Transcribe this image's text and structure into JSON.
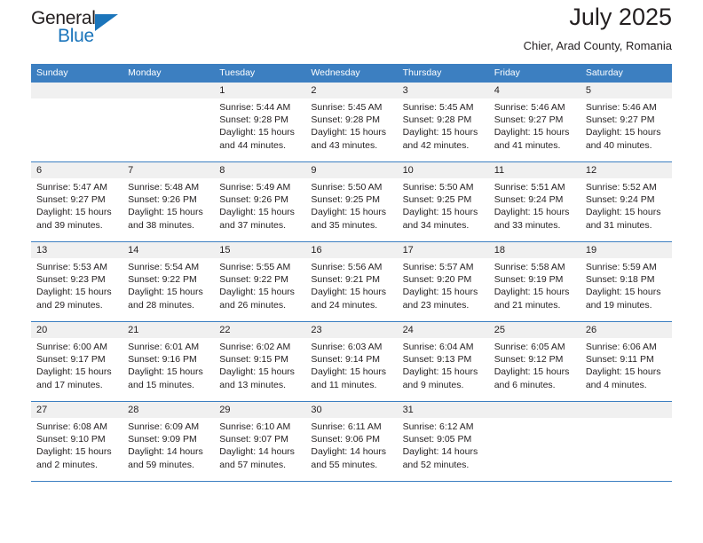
{
  "logo": {
    "word_top": "General",
    "word_bottom": "Blue",
    "triangle_color": "#1b75bb",
    "icon": "general-blue-logo"
  },
  "header": {
    "title": "July 2025",
    "subtitle": "Chier, Arad County, Romania"
  },
  "colors": {
    "header_blue": "#3c7fc1",
    "daynum_band": "#f0f0f0",
    "text": "#231f20",
    "logo_blue": "#1b75bb"
  },
  "weekday_headers": [
    "Sunday",
    "Monday",
    "Tuesday",
    "Wednesday",
    "Thursday",
    "Friday",
    "Saturday"
  ],
  "weeks": [
    [
      {
        "day": "",
        "lines": []
      },
      {
        "day": "",
        "lines": []
      },
      {
        "day": "1",
        "lines": [
          "Sunrise: 5:44 AM",
          "Sunset: 9:28 PM",
          "Daylight: 15 hours",
          "and 44 minutes."
        ]
      },
      {
        "day": "2",
        "lines": [
          "Sunrise: 5:45 AM",
          "Sunset: 9:28 PM",
          "Daylight: 15 hours",
          "and 43 minutes."
        ]
      },
      {
        "day": "3",
        "lines": [
          "Sunrise: 5:45 AM",
          "Sunset: 9:28 PM",
          "Daylight: 15 hours",
          "and 42 minutes."
        ]
      },
      {
        "day": "4",
        "lines": [
          "Sunrise: 5:46 AM",
          "Sunset: 9:27 PM",
          "Daylight: 15 hours",
          "and 41 minutes."
        ]
      },
      {
        "day": "5",
        "lines": [
          "Sunrise: 5:46 AM",
          "Sunset: 9:27 PM",
          "Daylight: 15 hours",
          "and 40 minutes."
        ]
      }
    ],
    [
      {
        "day": "6",
        "lines": [
          "Sunrise: 5:47 AM",
          "Sunset: 9:27 PM",
          "Daylight: 15 hours",
          "and 39 minutes."
        ]
      },
      {
        "day": "7",
        "lines": [
          "Sunrise: 5:48 AM",
          "Sunset: 9:26 PM",
          "Daylight: 15 hours",
          "and 38 minutes."
        ]
      },
      {
        "day": "8",
        "lines": [
          "Sunrise: 5:49 AM",
          "Sunset: 9:26 PM",
          "Daylight: 15 hours",
          "and 37 minutes."
        ]
      },
      {
        "day": "9",
        "lines": [
          "Sunrise: 5:50 AM",
          "Sunset: 9:25 PM",
          "Daylight: 15 hours",
          "and 35 minutes."
        ]
      },
      {
        "day": "10",
        "lines": [
          "Sunrise: 5:50 AM",
          "Sunset: 9:25 PM",
          "Daylight: 15 hours",
          "and 34 minutes."
        ]
      },
      {
        "day": "11",
        "lines": [
          "Sunrise: 5:51 AM",
          "Sunset: 9:24 PM",
          "Daylight: 15 hours",
          "and 33 minutes."
        ]
      },
      {
        "day": "12",
        "lines": [
          "Sunrise: 5:52 AM",
          "Sunset: 9:24 PM",
          "Daylight: 15 hours",
          "and 31 minutes."
        ]
      }
    ],
    [
      {
        "day": "13",
        "lines": [
          "Sunrise: 5:53 AM",
          "Sunset: 9:23 PM",
          "Daylight: 15 hours",
          "and 29 minutes."
        ]
      },
      {
        "day": "14",
        "lines": [
          "Sunrise: 5:54 AM",
          "Sunset: 9:22 PM",
          "Daylight: 15 hours",
          "and 28 minutes."
        ]
      },
      {
        "day": "15",
        "lines": [
          "Sunrise: 5:55 AM",
          "Sunset: 9:22 PM",
          "Daylight: 15 hours",
          "and 26 minutes."
        ]
      },
      {
        "day": "16",
        "lines": [
          "Sunrise: 5:56 AM",
          "Sunset: 9:21 PM",
          "Daylight: 15 hours",
          "and 24 minutes."
        ]
      },
      {
        "day": "17",
        "lines": [
          "Sunrise: 5:57 AM",
          "Sunset: 9:20 PM",
          "Daylight: 15 hours",
          "and 23 minutes."
        ]
      },
      {
        "day": "18",
        "lines": [
          "Sunrise: 5:58 AM",
          "Sunset: 9:19 PM",
          "Daylight: 15 hours",
          "and 21 minutes."
        ]
      },
      {
        "day": "19",
        "lines": [
          "Sunrise: 5:59 AM",
          "Sunset: 9:18 PM",
          "Daylight: 15 hours",
          "and 19 minutes."
        ]
      }
    ],
    [
      {
        "day": "20",
        "lines": [
          "Sunrise: 6:00 AM",
          "Sunset: 9:17 PM",
          "Daylight: 15 hours",
          "and 17 minutes."
        ]
      },
      {
        "day": "21",
        "lines": [
          "Sunrise: 6:01 AM",
          "Sunset: 9:16 PM",
          "Daylight: 15 hours",
          "and 15 minutes."
        ]
      },
      {
        "day": "22",
        "lines": [
          "Sunrise: 6:02 AM",
          "Sunset: 9:15 PM",
          "Daylight: 15 hours",
          "and 13 minutes."
        ]
      },
      {
        "day": "23",
        "lines": [
          "Sunrise: 6:03 AM",
          "Sunset: 9:14 PM",
          "Daylight: 15 hours",
          "and 11 minutes."
        ]
      },
      {
        "day": "24",
        "lines": [
          "Sunrise: 6:04 AM",
          "Sunset: 9:13 PM",
          "Daylight: 15 hours",
          "and 9 minutes."
        ]
      },
      {
        "day": "25",
        "lines": [
          "Sunrise: 6:05 AM",
          "Sunset: 9:12 PM",
          "Daylight: 15 hours",
          "and 6 minutes."
        ]
      },
      {
        "day": "26",
        "lines": [
          "Sunrise: 6:06 AM",
          "Sunset: 9:11 PM",
          "Daylight: 15 hours",
          "and 4 minutes."
        ]
      }
    ],
    [
      {
        "day": "27",
        "lines": [
          "Sunrise: 6:08 AM",
          "Sunset: 9:10 PM",
          "Daylight: 15 hours",
          "and 2 minutes."
        ]
      },
      {
        "day": "28",
        "lines": [
          "Sunrise: 6:09 AM",
          "Sunset: 9:09 PM",
          "Daylight: 14 hours",
          "and 59 minutes."
        ]
      },
      {
        "day": "29",
        "lines": [
          "Sunrise: 6:10 AM",
          "Sunset: 9:07 PM",
          "Daylight: 14 hours",
          "and 57 minutes."
        ]
      },
      {
        "day": "30",
        "lines": [
          "Sunrise: 6:11 AM",
          "Sunset: 9:06 PM",
          "Daylight: 14 hours",
          "and 55 minutes."
        ]
      },
      {
        "day": "31",
        "lines": [
          "Sunrise: 6:12 AM",
          "Sunset: 9:05 PM",
          "Daylight: 14 hours",
          "and 52 minutes."
        ]
      },
      {
        "day": "",
        "lines": []
      },
      {
        "day": "",
        "lines": []
      }
    ]
  ]
}
